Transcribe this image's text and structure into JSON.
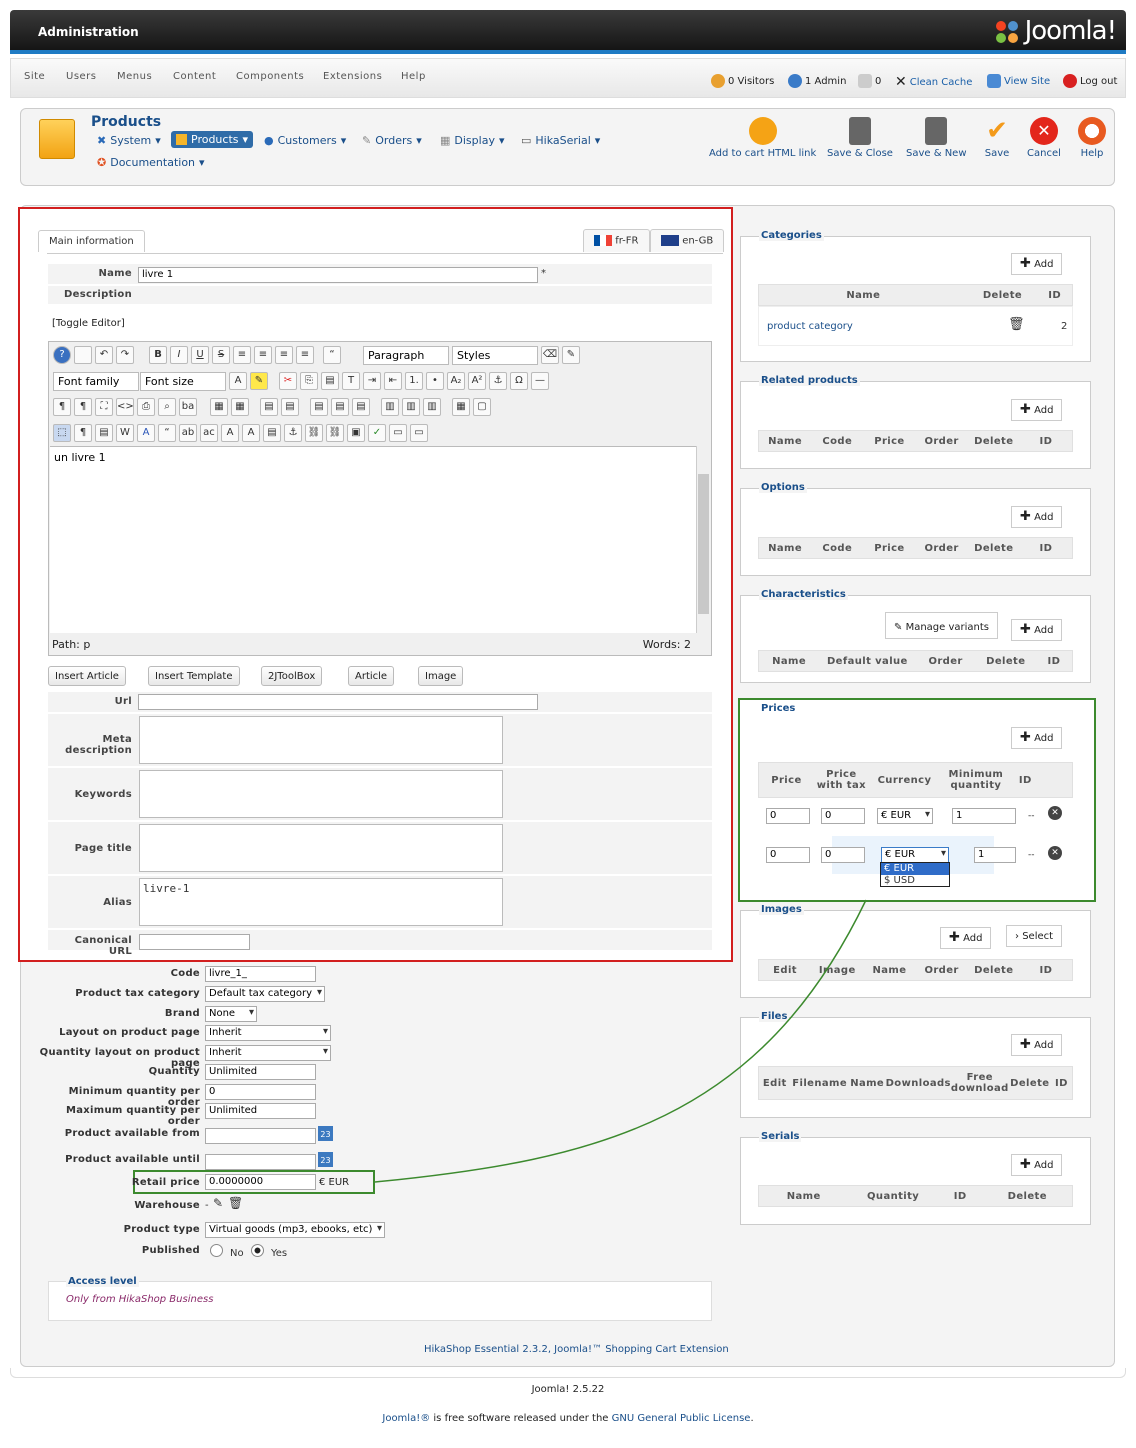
{
  "header": {
    "title": "Administration",
    "logo": "Joomla!"
  },
  "menu": [
    "Site",
    "Users",
    "Menus",
    "Content",
    "Components",
    "Extensions",
    "Help"
  ],
  "status": {
    "visitors": "0 Visitors",
    "admins": "1 Admin",
    "messages": "0",
    "clean_cache": "Clean Cache",
    "view_site": "View Site",
    "logout": "Log out"
  },
  "toolbar": {
    "title": "Products",
    "nav": [
      "System",
      "Products",
      "Customers",
      "Orders",
      "Display",
      "HikaSerial",
      "Documentation"
    ],
    "buttons": [
      "Add to cart HTML link",
      "Save & Close",
      "Save & New",
      "Save",
      "Cancel",
      "Help"
    ]
  },
  "form": {
    "tab_main": "Main information",
    "lang_fr": "fr-FR",
    "lang_en": "en-GB",
    "name_label": "Name",
    "name_value": "livre 1",
    "required_mark": "*",
    "description_label": "Description",
    "toggle_editor": "[Toggle Editor]",
    "paragraph": "Paragraph",
    "styles": "Styles",
    "font_family": "Font family",
    "font_size": "Font size",
    "editor_text": "un livre 1",
    "path": "Path:  p",
    "words": "Words: 2",
    "insert_buttons": [
      "Insert Article",
      "Insert Template",
      "2JToolBox",
      "Article",
      "Image"
    ],
    "url_label": "Url",
    "meta_label": "Meta description",
    "keywords_label": "Keywords",
    "page_title_label": "Page title",
    "alias_label": "Alias",
    "alias_value": "livre-1",
    "canonical_label": "Canonical URL"
  },
  "details": {
    "code_label": "Code",
    "code_value": "livre_1_",
    "tax_label": "Product tax category",
    "tax_value": "Default tax category",
    "brand_label": "Brand",
    "brand_value": "None",
    "layout_label": "Layout on product page",
    "layout_value": "Inherit",
    "qlayout_label": "Quantity layout on product page",
    "qlayout_value": "Inherit",
    "quantity_label": "Quantity",
    "quantity_value": "Unlimited",
    "min_label": "Minimum quantity per order",
    "min_value": "0",
    "max_label": "Maximum quantity per order",
    "max_value": "Unlimited",
    "from_label": "Product available from",
    "until_label": "Product available until",
    "retail_label": "Retail price",
    "retail_value": "0.0000000",
    "retail_currency": "€ EUR",
    "warehouse_label": "Warehouse",
    "warehouse_value": "-",
    "type_label": "Product type",
    "type_value": "Virtual goods (mp3, ebooks, etc)",
    "published_label": "Published",
    "no": "No",
    "yes": "Yes",
    "access_legend": "Access level",
    "access_value": "Only from HikaShop Business",
    "calendar_num": "23"
  },
  "right": {
    "categories": {
      "legend": "Categories",
      "add": "Add",
      "cols": [
        "Name",
        "Delete",
        "ID"
      ],
      "row": {
        "name": "product category",
        "id": "2"
      }
    },
    "related": {
      "legend": "Related products",
      "add": "Add",
      "cols": [
        "Name",
        "Code",
        "Price",
        "Order",
        "Delete",
        "ID"
      ]
    },
    "options": {
      "legend": "Options",
      "add": "Add",
      "cols": [
        "Name",
        "Code",
        "Price",
        "Order",
        "Delete",
        "ID"
      ]
    },
    "characteristics": {
      "legend": "Characteristics",
      "manage": "Manage variants",
      "add": "Add",
      "cols": [
        "Name",
        "Default value",
        "Order",
        "Delete",
        "ID"
      ]
    },
    "prices": {
      "legend": "Prices",
      "add": "Add",
      "cols": [
        "Price",
        "Price with tax",
        "Currency",
        "Minimum quantity",
        "ID"
      ],
      "rows": [
        {
          "price": "0",
          "tax": "0",
          "currency": "€ EUR",
          "qty": "1",
          "id": "--"
        },
        {
          "price": "0",
          "tax": "0",
          "currency": "€ EUR",
          "qty": "1",
          "id": "--"
        }
      ],
      "dropdown": [
        "€ EUR",
        "$ USD"
      ]
    },
    "images": {
      "legend": "Images",
      "add": "Add",
      "select": "Select",
      "cols": [
        "Edit",
        "Image",
        "Name",
        "Order",
        "Delete",
        "ID"
      ]
    },
    "files": {
      "legend": "Files",
      "add": "Add",
      "cols": [
        "Edit",
        "Filename",
        "Name",
        "Downloads",
        "Free download",
        "Delete",
        "ID"
      ]
    },
    "serials": {
      "legend": "Serials",
      "add": "Add",
      "cols": [
        "Name",
        "Quantity",
        "ID",
        "Delete"
      ]
    }
  },
  "footer": {
    "hikashop": "HikaShop Essential 2.3.2, Joomla!™ Shopping Cart Extension",
    "version": "Joomla! 2.5.22",
    "license_pre": "Joomla!®",
    "license_mid": " is free software released under the ",
    "license_link": "GNU General Public License",
    "license_end": "."
  },
  "colors": {
    "accent": "#1a4f8a",
    "highlight_red": "#d21f1f",
    "highlight_green": "#3c8a2e"
  }
}
